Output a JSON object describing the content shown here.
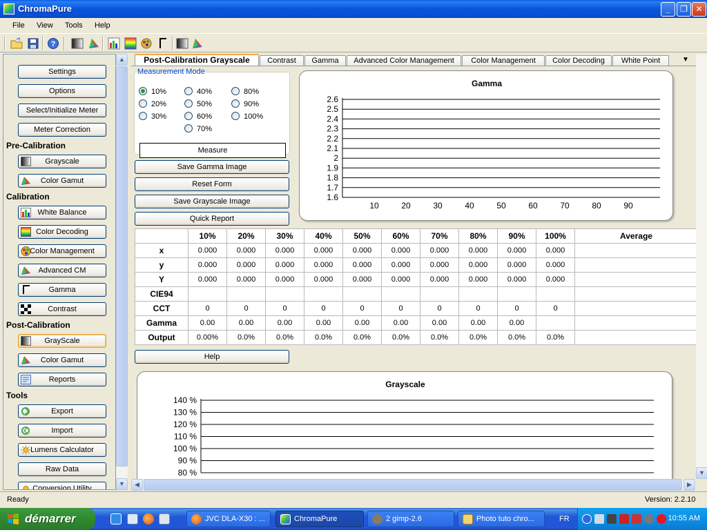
{
  "window": {
    "title": "ChromaPure"
  },
  "menu": [
    "File",
    "View",
    "Tools",
    "Help"
  ],
  "sidebar": {
    "top_buttons": [
      "Settings",
      "Options",
      "Select/Initialize Meter",
      "Meter Correction"
    ],
    "groups": {
      "pre": "Pre-Calibration",
      "cal": "Calibration",
      "post": "Post-Calibration",
      "tools": "Tools"
    },
    "pre_buttons": [
      "Grayscale",
      "Color Gamut"
    ],
    "cal_buttons": [
      "White Balance",
      "Color Decoding",
      "Color Management",
      "Advanced CM",
      "Gamma",
      "Contrast"
    ],
    "post_buttons": [
      "GrayScale",
      "Color Gamut",
      "Reports"
    ],
    "tools_buttons": [
      "Export",
      "Import",
      "Lumens Calculator",
      "Raw Data",
      "Conversion Utility"
    ]
  },
  "tabs": [
    "Post-Calibration Grayscale",
    "Contrast",
    "Gamma",
    "Advanced Color Management",
    "Color Management",
    "Color Decoding",
    "White Point"
  ],
  "tab_controls": {
    "dropdown": "▼",
    "close": "✕"
  },
  "measurement": {
    "legend": "Measurement Mode",
    "options": [
      "10%",
      "20%",
      "30%",
      "40%",
      "50%",
      "60%",
      "70%",
      "80%",
      "90%",
      "100%"
    ],
    "selected": "10%",
    "measure_label": "Measure"
  },
  "actions": [
    "Save Gamma Image",
    "Reset Form",
    "Save Grayscale Image",
    "Quick Report"
  ],
  "help_label": "Help",
  "table": {
    "columns": [
      "",
      "10%",
      "20%",
      "30%",
      "40%",
      "50%",
      "60%",
      "70%",
      "80%",
      "90%",
      "100%",
      "Average"
    ],
    "rows": [
      {
        "label": "x",
        "cells": [
          "0.000",
          "0.000",
          "0.000",
          "0.000",
          "0.000",
          "0.000",
          "0.000",
          "0.000",
          "0.000",
          "0.000",
          ""
        ]
      },
      {
        "label": "y",
        "cells": [
          "0.000",
          "0.000",
          "0.000",
          "0.000",
          "0.000",
          "0.000",
          "0.000",
          "0.000",
          "0.000",
          "0.000",
          ""
        ]
      },
      {
        "label": "Y",
        "cells": [
          "0.000",
          "0.000",
          "0.000",
          "0.000",
          "0.000",
          "0.000",
          "0.000",
          "0.000",
          "0.000",
          "0.000",
          ""
        ]
      },
      {
        "label": "CIE94",
        "cells": [
          "",
          "",
          "",
          "",
          "",
          "",
          "",
          "",
          "",
          "",
          ""
        ]
      },
      {
        "label": "CCT",
        "cells": [
          "0",
          "0",
          "0",
          "0",
          "0",
          "0",
          "0",
          "0",
          "0",
          "0",
          ""
        ]
      },
      {
        "label": "Gamma",
        "cells": [
          "0.00",
          "0.00",
          "0.00",
          "0.00",
          "0.00",
          "0.00",
          "0.00",
          "0.00",
          "0.00",
          "",
          ""
        ]
      },
      {
        "label": "Output",
        "cells": [
          "0.00%",
          "0.0%",
          "0.0%",
          "0.0%",
          "0.0%",
          "0.0%",
          "0.0%",
          "0.0%",
          "0.0%",
          "0.0%",
          ""
        ]
      }
    ]
  },
  "chart_data": [
    {
      "type": "line",
      "title": "Gamma",
      "x_ticks": [
        "10",
        "20",
        "30",
        "40",
        "50",
        "60",
        "70",
        "80",
        "90"
      ],
      "y_ticks": [
        "2.6",
        "2.5",
        "2.4",
        "2.3",
        "2.2",
        "2.1",
        "2",
        "1.9",
        "1.8",
        "1.7",
        "1.6"
      ],
      "xlim": [
        0,
        100
      ],
      "ylim": [
        1.6,
        2.6
      ],
      "grid": true,
      "series": []
    },
    {
      "type": "line",
      "title": "Grayscale",
      "y_ticks": [
        "140 %",
        "130 %",
        "120 %",
        "110 %",
        "100 %",
        "90 %",
        "80 %"
      ],
      "ylim": [
        80,
        140
      ],
      "grid": true,
      "series": []
    }
  ],
  "status": {
    "left": "Ready",
    "right": "Version: 2.2.10"
  },
  "taskbar": {
    "start": "démarrer",
    "tasks": [
      "JVC DLA-X30 : ...",
      "ChromaPure",
      "2 gimp-2.6",
      "Photo tuto chro..."
    ],
    "lang": "FR",
    "clock": "10:55 AM"
  },
  "colors": {
    "title_blue": "#0854dd",
    "tab_accent": "#f1a943",
    "start_green": "#2f8a2f"
  }
}
